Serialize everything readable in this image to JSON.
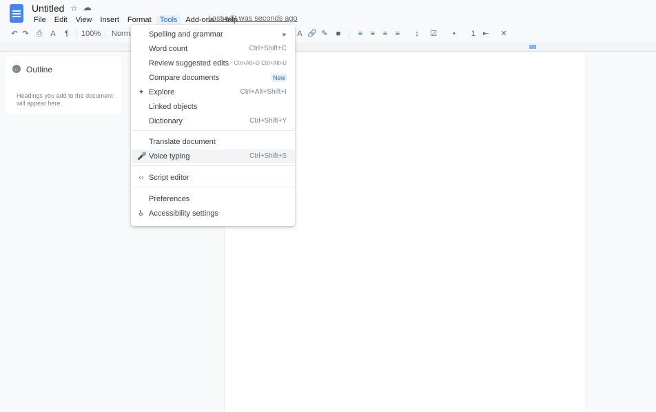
{
  "app": {
    "title": "Untitled",
    "last_edit": "Last edit was seconds ago"
  },
  "menubar": {
    "items": [
      {
        "label": "File"
      },
      {
        "label": "Edit"
      },
      {
        "label": "View"
      },
      {
        "label": "Insert"
      },
      {
        "label": "Format"
      },
      {
        "label": "Tools"
      },
      {
        "label": "Add-ons"
      },
      {
        "label": "Help"
      }
    ]
  },
  "toolbar": {
    "zoom": "100%",
    "style": "Normal text"
  },
  "outline": {
    "title": "Outline",
    "hint": "Headings you add to the document will appear here."
  },
  "tools_menu": {
    "items": [
      {
        "label": "Spelling and grammar",
        "shortcut": ""
      },
      {
        "label": "Word count",
        "shortcut": "Ctrl+Shift+C"
      },
      {
        "label": "Review suggested edits",
        "shortcut": "Ctrl+Alt+O Ctrl+Alt+U"
      },
      {
        "label": "Compare documents",
        "chip": "New"
      },
      {
        "label": "Explore",
        "shortcut": "Ctrl+Alt+Shift+I"
      },
      {
        "label": "Linked objects",
        "shortcut": ""
      },
      {
        "label": "Dictionary",
        "shortcut": "Ctrl+Shift+Y"
      },
      {
        "label": "Translate document",
        "shortcut": ""
      },
      {
        "label": "Voice typing",
        "shortcut": "Ctrl+Shift+S"
      },
      {
        "label": "Script editor",
        "shortcut": ""
      },
      {
        "label": "Preferences",
        "shortcut": ""
      },
      {
        "label": "Accessibility settings",
        "shortcut": ""
      }
    ]
  },
  "colors": {
    "accent": "#1a73e8",
    "doc_icon": "#4285f4"
  }
}
